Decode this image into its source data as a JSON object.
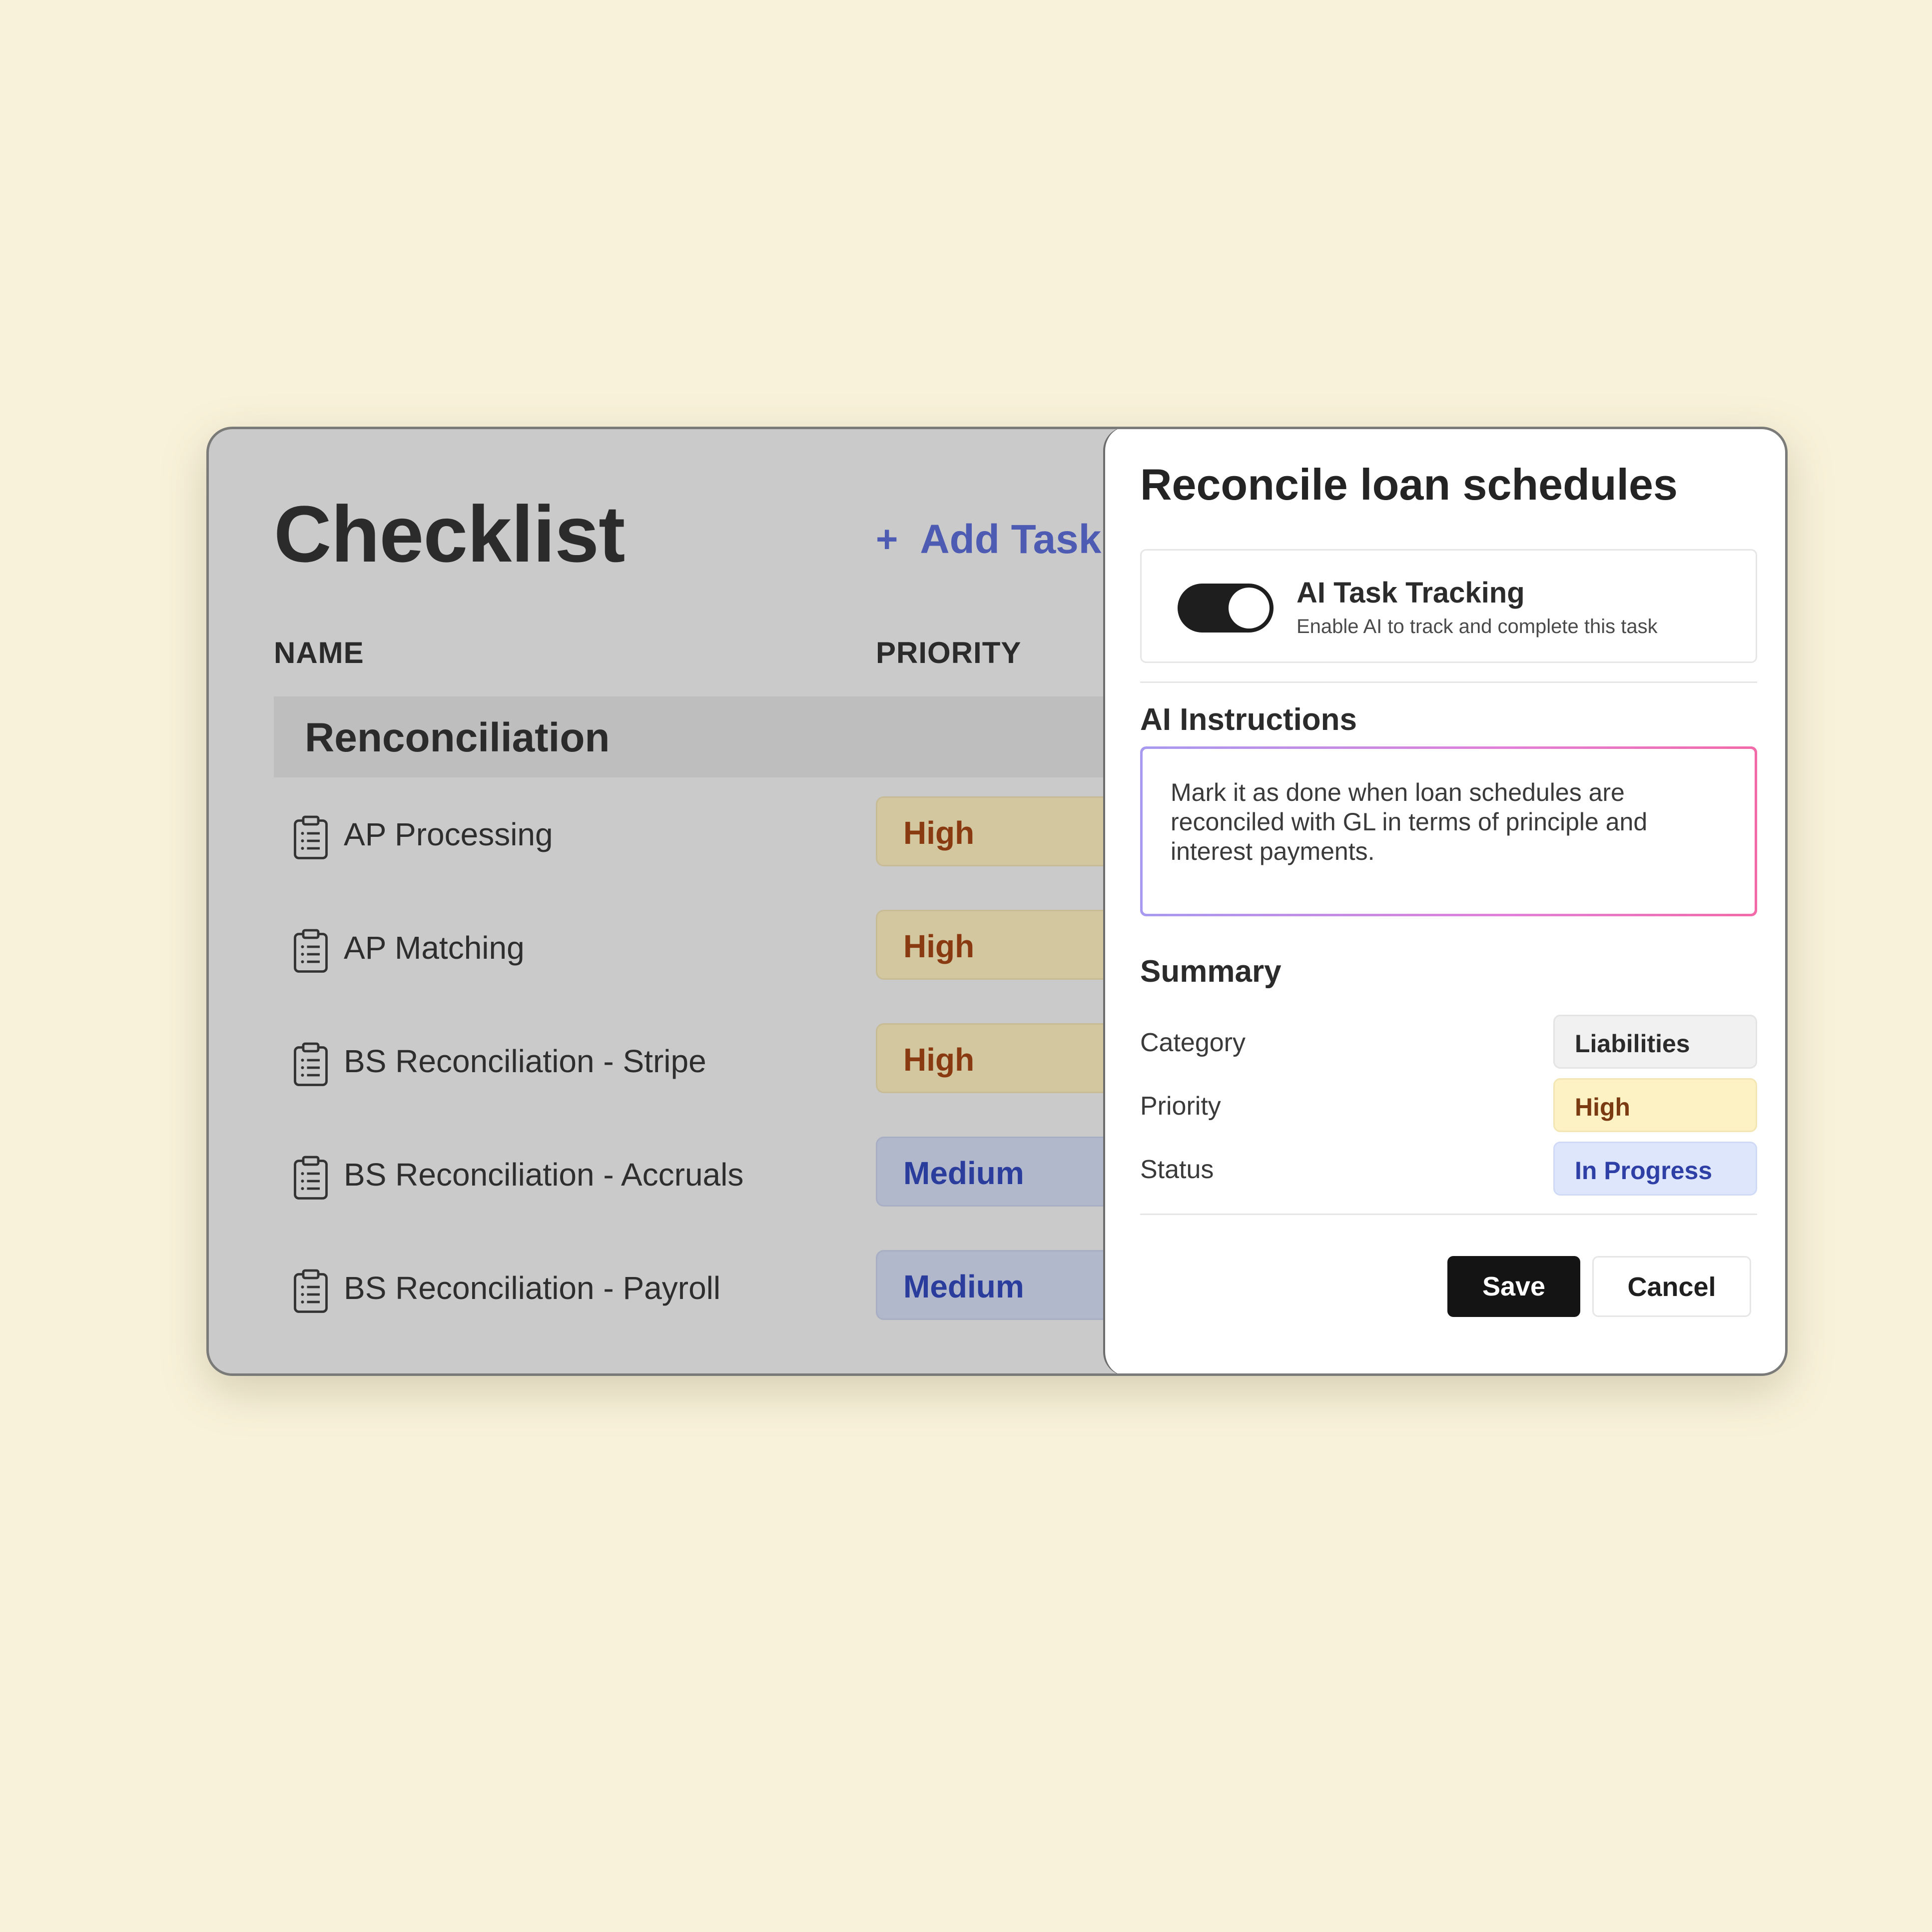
{
  "checklist": {
    "title": "Checklist",
    "add_task_icon": "+",
    "add_task_label": "Add Task",
    "columns": {
      "name": "NAME",
      "priority": "PRIORITY"
    },
    "group": "Renconciliation",
    "tasks": [
      {
        "name": "AP Processing",
        "priority": "High",
        "icon": "clipboard-icon"
      },
      {
        "name": "AP Matching",
        "priority": "High",
        "icon": "clipboard-icon"
      },
      {
        "name": "BS Reconciliation - Stripe",
        "priority": "High",
        "icon": "clipboard-icon"
      },
      {
        "name": "BS Reconciliation - Accruals",
        "priority": "Medium",
        "icon": "clipboard-icon"
      },
      {
        "name": "BS Reconciliation - Payroll",
        "priority": "Medium",
        "icon": "clipboard-icon"
      }
    ]
  },
  "panel": {
    "title": "Reconcile loan schedules",
    "ai_tracking": {
      "enabled": true,
      "title": "AI Task Tracking",
      "subtitle": "Enable AI to track and complete this task"
    },
    "instructions_label": "AI Instructions",
    "instructions_text": "Mark it as done when loan schedules are reconciled with GL in terms of principle and interest payments.",
    "summary_label": "Summary",
    "summary": {
      "category": {
        "key": "Category",
        "value": "Liabilities"
      },
      "priority": {
        "key": "Priority",
        "value": "High"
      },
      "status": {
        "key": "Status",
        "value": "In Progress"
      }
    },
    "save_label": "Save",
    "cancel_label": "Cancel"
  },
  "colors": {
    "background": "#f9f2da",
    "accent": "#4e5bb3",
    "priority_high_text": "#8a3a10",
    "priority_medium_text": "#2a3d9c",
    "status_text": "#2e3fa6"
  }
}
